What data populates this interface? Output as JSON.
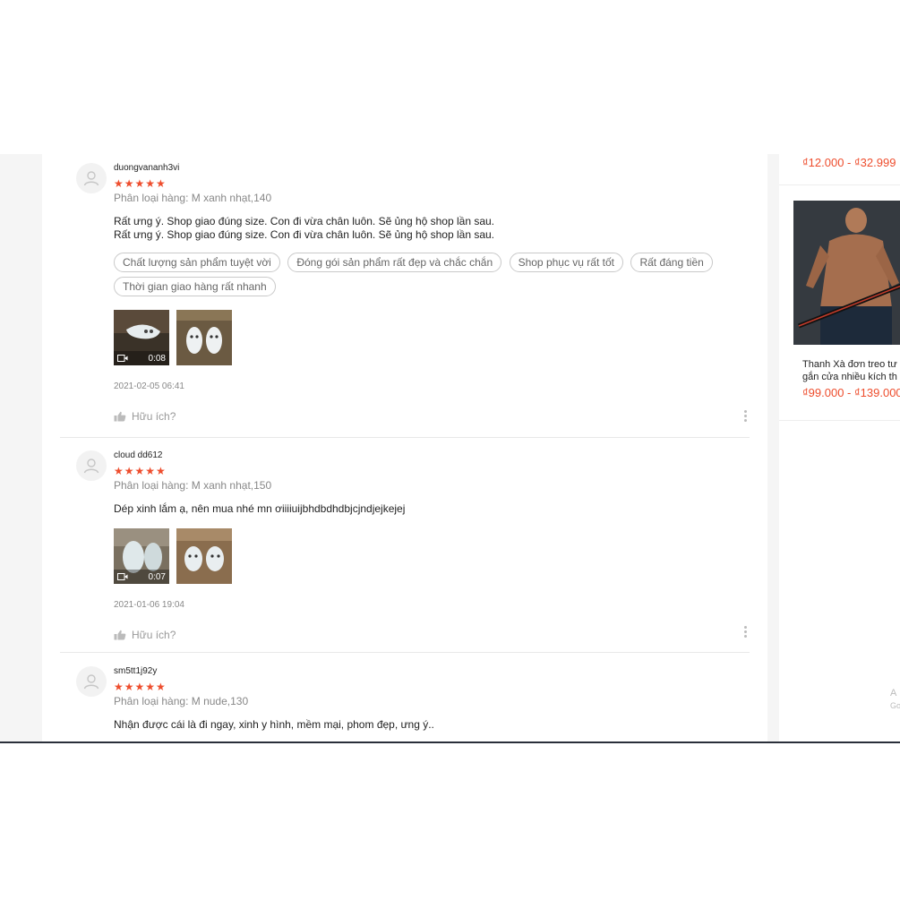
{
  "reviews": [
    {
      "username": "duongvananh3vi",
      "stars": "★★★★★",
      "variant": "Phân loại hàng: M xanh nhạt,140",
      "comment_lines": [
        "Rất ưng ý. Shop giao đúng size. Con đi vừa chân luôn. Sẽ ủng hộ shop lần sau.",
        "Rất ưng ý. Shop giao đúng size. Con đi vừa chân luôn. Sẽ ủng hộ shop lần sau."
      ],
      "tags": [
        "Chất lượng sản phẩm tuyệt vời",
        "Đóng gói sản phẩm rất đẹp và chắc chắn",
        "Shop phục vụ rất tốt",
        "Rất đáng tiền",
        "Thời gian giao hàng rất nhanh"
      ],
      "video_duration": "0:08",
      "date": "2021-02-05 06:41",
      "helpful_label": "Hữu ích?"
    },
    {
      "username": "cloud dd612",
      "stars": "★★★★★",
      "variant": "Phân loại hàng: M xanh nhạt,150",
      "comment_lines": [
        "Dép xinh lắm ạ, nên mua nhé mn ơiiiiuijbhdbdhdbjcjndjejkejej"
      ],
      "tags": [],
      "video_duration": "0:07",
      "date": "2021-01-06 19:04",
      "helpful_label": "Hữu ích?"
    },
    {
      "username": "sm5tt1j92y",
      "stars": "★★★★★",
      "variant": "Phân loại hàng: M nude,130",
      "comment_lines": [
        "Nhận được cái là đi ngay, xinh y hình, mềm mại, phom đẹp, ưng ý.."
      ]
    }
  ],
  "sidebar": {
    "top_price": "₫12.000 - ₫32.999",
    "product": {
      "title_line1": "Thanh Xà đơn treo tư",
      "title_line2": "gắn cửa nhiều kích th",
      "price": "₫99.000 - ₫139.000"
    },
    "corner_text_1": "A",
    "corner_text_2": "Go"
  },
  "colors": {
    "accent": "#ee4d2d"
  }
}
